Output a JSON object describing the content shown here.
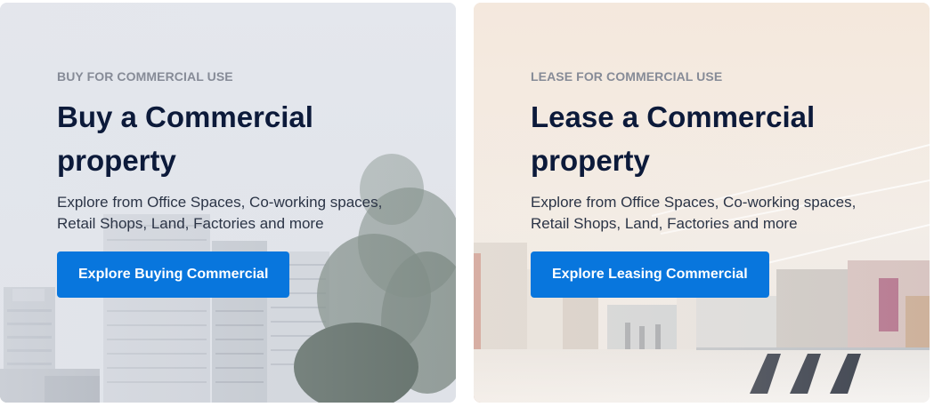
{
  "cards": [
    {
      "eyebrow": "BUY FOR COMMERCIAL USE",
      "title": "Buy a Commercial property",
      "description": "Explore from Office Spaces, Co-working spaces, Retail Shops, Land, Factories and more",
      "button_label": "Explore Buying Commercial",
      "background_image": "commercial-buildings-photo"
    },
    {
      "eyebrow": "LEASE FOR COMMERCIAL USE",
      "title": "Lease a Commercial property",
      "description": "Explore from Office Spaces, Co-working spaces, Retail Shops, Land, Factories and more",
      "button_label": "Explore Leasing Commercial",
      "background_image": "shopping-mall-interior-photo"
    }
  ],
  "colors": {
    "button": "#0876dd",
    "title": "#0c1a3a",
    "eyebrow": "#868b97",
    "buy_card_bg": "#e3e6ec",
    "lease_card_bg": "#f3e9df"
  }
}
